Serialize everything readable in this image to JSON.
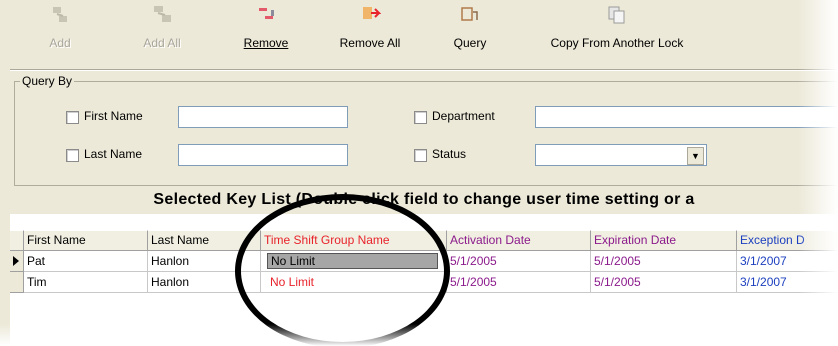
{
  "toolbar": {
    "add": "Add",
    "add_all": "Add All",
    "remove": "Remove",
    "remove_all": "Remove All",
    "query": "Query",
    "copy": "Copy From Another Lock"
  },
  "query_by": {
    "title": "Query By",
    "first_name_label": "First Name",
    "last_name_label": "Last Name",
    "department_label": "Department",
    "status_label": "Status",
    "first_name_value": "",
    "last_name_value": "",
    "department_value": "",
    "status_value": ""
  },
  "grid": {
    "title": "Selected Key List  (Double click field to change user time setting or  a",
    "columns": [
      "First Name",
      "Last Name",
      "Time Shift Group Name",
      "Activation Date",
      "Expiration Date",
      "Exception D"
    ],
    "rows": [
      [
        "Pat",
        "Hanlon",
        "No Limit",
        "5/1/2005",
        "5/1/2005",
        "3/1/2007"
      ],
      [
        "Tim",
        "Hanlon",
        "No Limit",
        "5/1/2005",
        "5/1/2005",
        "3/1/2007"
      ]
    ]
  },
  "colors": {
    "time_shift": "#e8232b",
    "dates": "#8b1a8b",
    "exception": "#1c3fbf"
  }
}
